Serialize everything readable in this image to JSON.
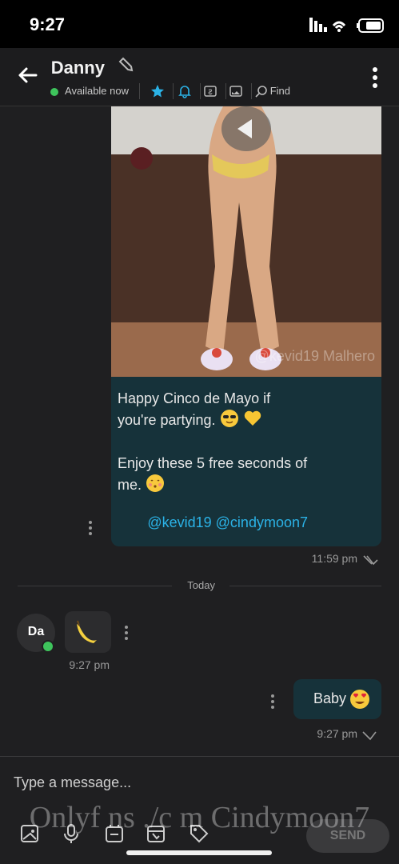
{
  "statusbar": {
    "time": "9:27"
  },
  "header": {
    "contact_name": "Danny",
    "status": "Available now",
    "find_label": "Find",
    "icons": [
      "back-arrow-icon",
      "edit-icon",
      "more-vertical-icon",
      "star-icon",
      "bell-icon",
      "tip-icon",
      "image-icon",
      "search-icon"
    ]
  },
  "messages": [
    {
      "watermark": "@kevid19 Malhero",
      "caption_1": "Happy Cinco de Mayo if you're partying.",
      "caption_2": "Enjoy these 5 free seconds of me.",
      "mentions": "@kevid19 @cindymoon7",
      "time": "11:59 pm"
    },
    {
      "divider": "Today"
    },
    {
      "avatar": "Da",
      "time": "9:27 pm"
    },
    {
      "text": "Baby",
      "time": "9:27 pm"
    }
  ],
  "composer": {
    "placeholder": "Type a message...",
    "send_label": "SEND"
  },
  "overlay_watermark": "Onlyf ns ./c m Cindymoon7",
  "colors": {
    "background": "#1f1f21",
    "bubble": "#16323a",
    "accent": "#2bb2e6",
    "online": "#3ec45c"
  }
}
